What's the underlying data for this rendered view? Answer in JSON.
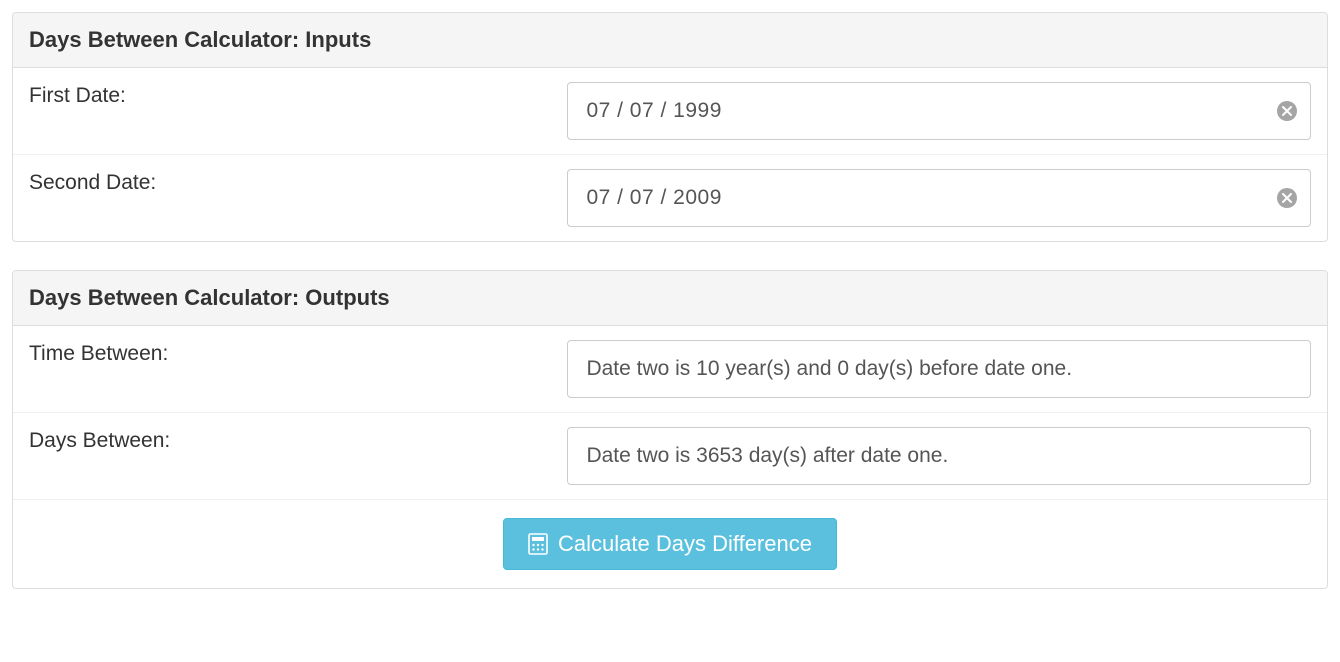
{
  "inputs": {
    "header": "Days Between Calculator: Inputs",
    "first_label": "First Date:",
    "first_value": "07 / 07 / 1999",
    "second_label": "Second Date:",
    "second_value": "07 / 07 / 2009"
  },
  "outputs": {
    "header": "Days Between Calculator: Outputs",
    "time_label": "Time Between:",
    "time_value": "Date two is 10 year(s) and 0 day(s) before date one.",
    "days_label": "Days Between:",
    "days_value": "Date two is 3653 day(s) after date one.",
    "button_label": "Calculate Days Difference"
  }
}
